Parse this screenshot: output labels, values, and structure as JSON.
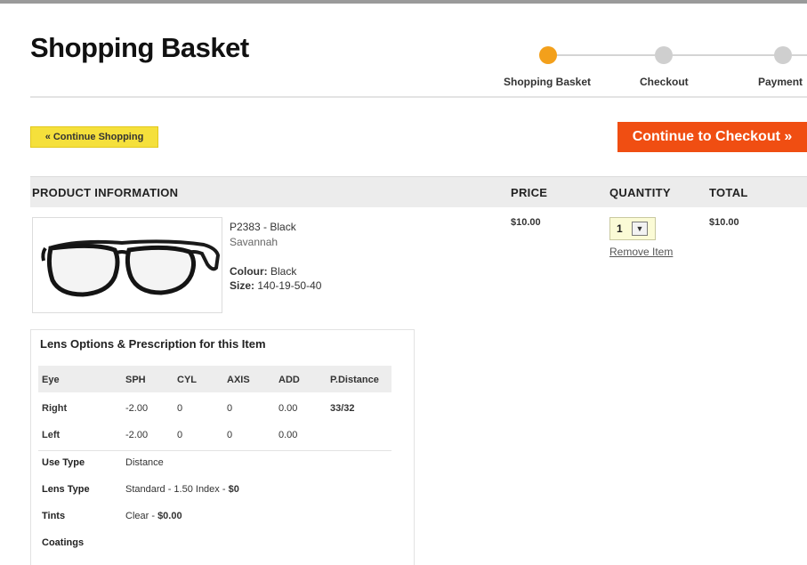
{
  "page": {
    "title": "Shopping Basket"
  },
  "steps": [
    {
      "label": "Shopping Basket",
      "active": true,
      "color": "#f3a01b"
    },
    {
      "label": "Checkout",
      "active": false,
      "color": "#cfcfcf"
    },
    {
      "label": "Payment",
      "active": false,
      "color": "#cfcfcf"
    }
  ],
  "buttons": {
    "continue_shopping": "« Continue Shopping",
    "continue_checkout": "Continue to Checkout »"
  },
  "table": {
    "headers": {
      "product": "PRODUCT INFORMATION",
      "price": "PRICE",
      "quantity": "QUANTITY",
      "total": "TOTAL"
    }
  },
  "item": {
    "code": "P2383 - Black",
    "name": "Savannah",
    "colour_label": "Colour:",
    "colour_value": "Black",
    "size_label": "Size:",
    "size_value": "140-19-50-40",
    "price": "$10.00",
    "quantity": "1",
    "total": "$10.00",
    "remove_label": "Remove Item"
  },
  "lens": {
    "title": "Lens Options & Prescription for this Item",
    "headers": [
      "Eye",
      "SPH",
      "CYL",
      "AXIS",
      "ADD",
      "P.Distance"
    ],
    "rows": [
      [
        "Right",
        "-2.00",
        "0",
        "0",
        "0.00",
        "33/32"
      ],
      [
        "Left",
        "-2.00",
        "0",
        "0",
        "0.00",
        ""
      ]
    ],
    "options": {
      "use_type_label": "Use Type",
      "use_type_value": "Distance",
      "lens_type_label": "Lens Type",
      "lens_type_value": "Standard - 1.50 Index - ",
      "lens_type_price": "$0",
      "tints_label": "Tints",
      "tints_value": "Clear - ",
      "tints_price": "$0.00",
      "coatings_label": "Coatings"
    }
  },
  "colors": {
    "accent": "#f04e12",
    "highlight": "#f5e03b",
    "step_active": "#f3a01b"
  }
}
